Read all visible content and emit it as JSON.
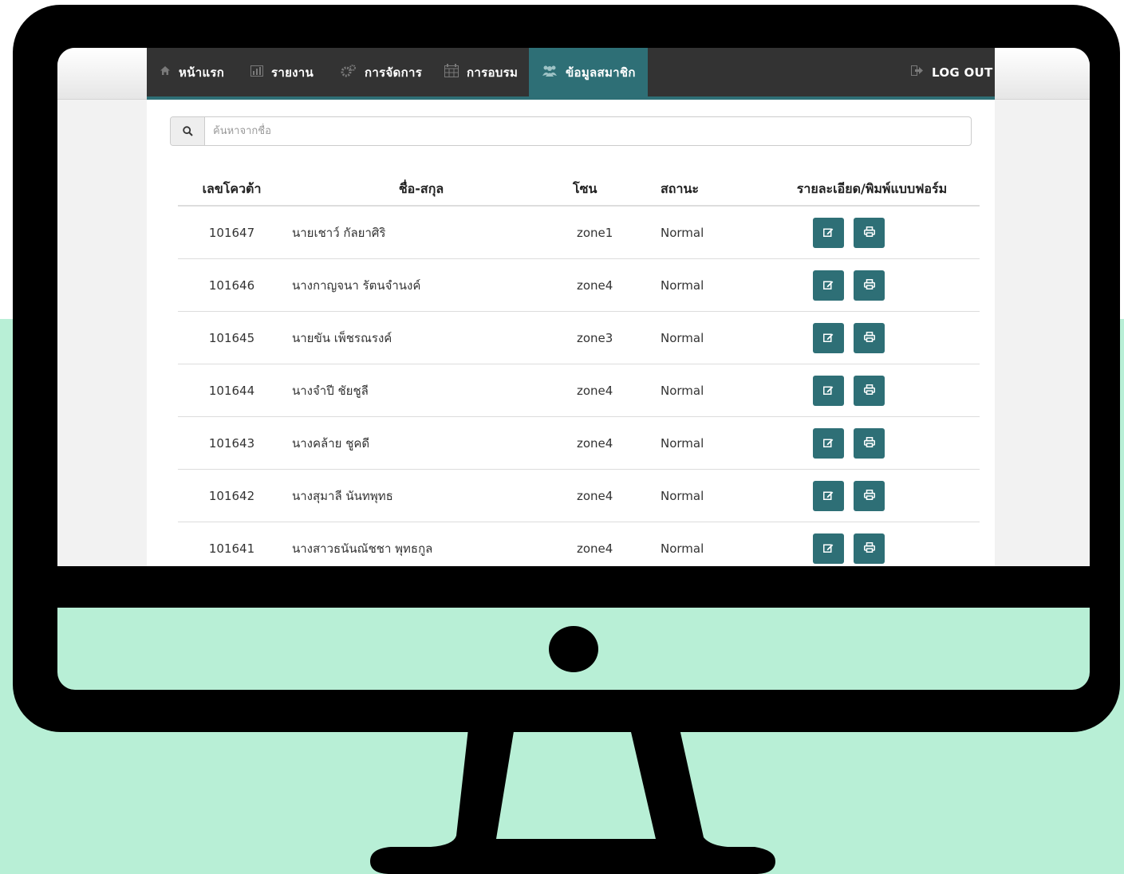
{
  "nav": {
    "items": [
      {
        "label": "หน้าแรก",
        "icon": "home-icon"
      },
      {
        "label": "รายงาน",
        "icon": "bar-chart-icon"
      },
      {
        "label": "การจัดการ",
        "icon": "cogs-icon"
      },
      {
        "label": "การอบรม",
        "icon": "calendar-icon"
      },
      {
        "label": "ข้อมูลสมาชิก",
        "icon": "users-icon",
        "active": true
      }
    ],
    "logout": "LOG OUT"
  },
  "search": {
    "placeholder": "ค้นหาจากชื่อ"
  },
  "table": {
    "headers": {
      "quota": "เลขโควต้า",
      "name": "ชื่อ-สกุล",
      "zone": "โซน",
      "status": "สถานะ",
      "actions": "รายละเอียด/พิมพ์แบบฟอร์ม"
    },
    "rows": [
      {
        "quota": "101647",
        "name": "นายเชาว์ กัลยาศิริ",
        "zone": "zone1",
        "status": "Normal"
      },
      {
        "quota": "101646",
        "name": "นางกาญจนา รัตนจำนงค์",
        "zone": "zone4",
        "status": "Normal"
      },
      {
        "quota": "101645",
        "name": "นายขัน เพ็ชรณรงค์",
        "zone": "zone3",
        "status": "Normal"
      },
      {
        "quota": "101644",
        "name": "นางจำปี ชัยชูลี",
        "zone": "zone4",
        "status": "Normal"
      },
      {
        "quota": "101643",
        "name": "นางคล้าย ชูคดี",
        "zone": "zone4",
        "status": "Normal"
      },
      {
        "quota": "101642",
        "name": "นางสุมาลี นันทพุทธ",
        "zone": "zone4",
        "status": "Normal"
      },
      {
        "quota": "101641",
        "name": "นางสาวธนันณัชชา พุทธกูล",
        "zone": "zone4",
        "status": "Normal"
      }
    ]
  },
  "colors": {
    "accent": "#2e6f76",
    "navbar": "#333333",
    "background_mint": "#b8efd6"
  }
}
